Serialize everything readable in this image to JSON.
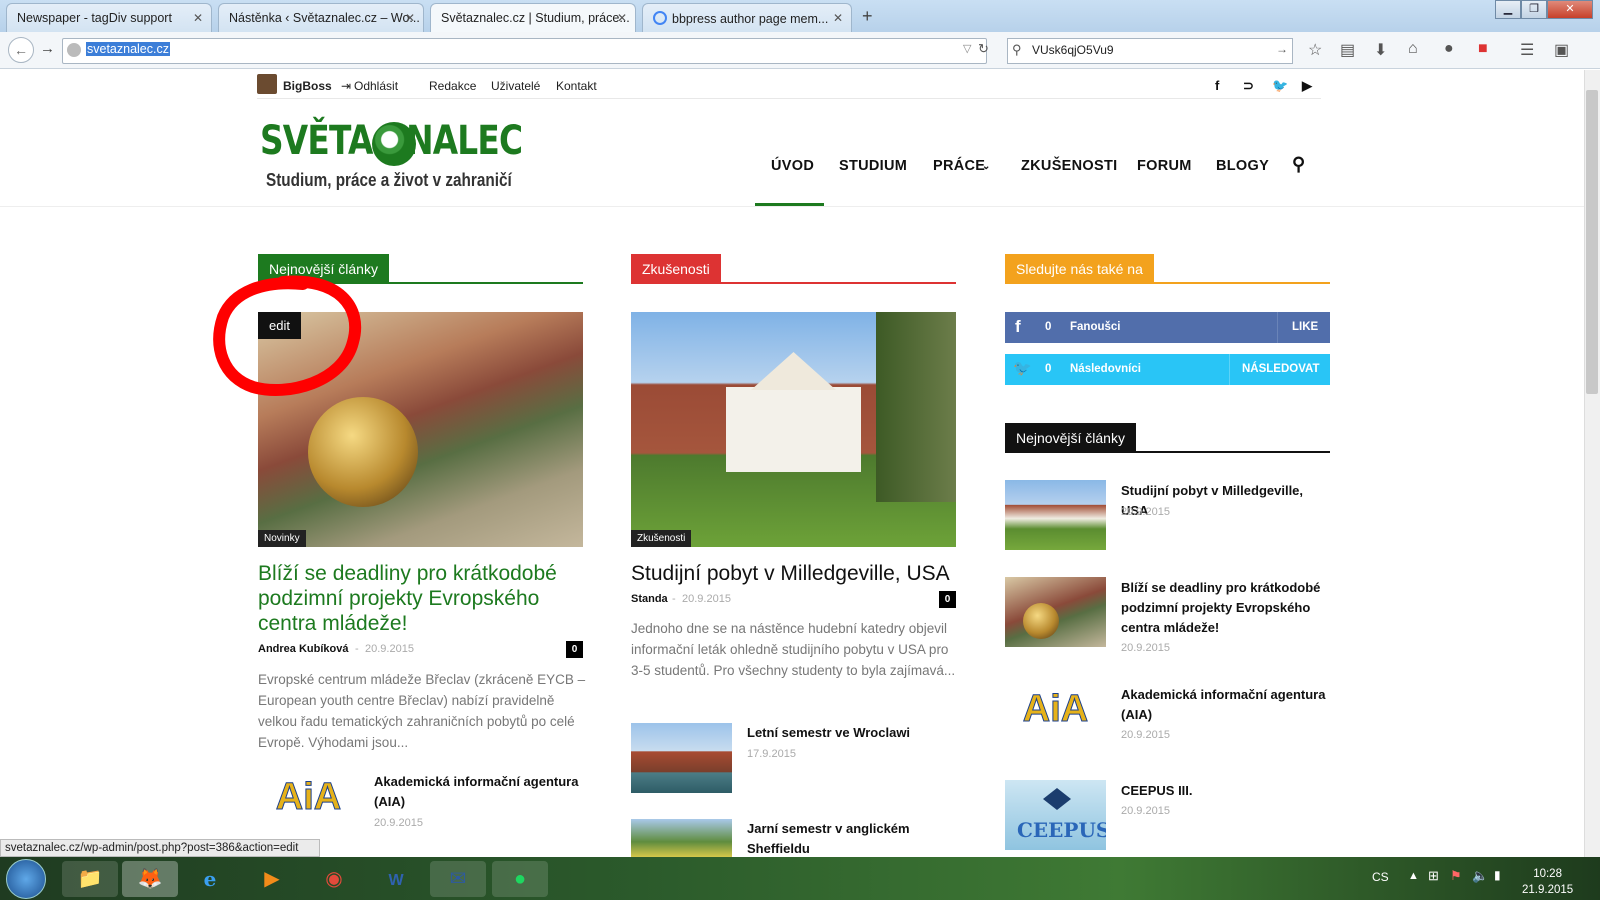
{
  "browser": {
    "tabs": [
      {
        "label": "Newspaper - tagDiv support"
      },
      {
        "label": "Nástěnka ‹ Světaznalec.cz – Wo..."
      },
      {
        "label": "Světaznalec.cz | Studium, práce..."
      },
      {
        "label": "bbpress author page mem..."
      }
    ],
    "url": "svetaznalec.cz",
    "search_query": "VUsk6qjO5Vu9",
    "status_url": "svetaznalec.cz/wp-admin/post.php?post=386&action=edit"
  },
  "topbar": {
    "user": "BigBoss",
    "logout": "Odhlásit",
    "menu": [
      "Redakce",
      "Uživatelé",
      "Kontakt"
    ]
  },
  "logo": {
    "line1": "SVĚTA  ZNALEC",
    "line2": "Studium, práce a život v zahraničí"
  },
  "main_nav": [
    "ÚVOD",
    "STUDIUM",
    "PRÁCE",
    "ZKUŠENOSTI",
    "FORUM",
    "BLOGY"
  ],
  "col1": {
    "heading": "Nejnovější články",
    "edit_label": "edit",
    "category": "Novinky",
    "title": "Blíží se deadliny pro krátkodobé podzimní projekty Evropského centra mládeže!",
    "author": "Andrea Kubíková",
    "date": "20.9.2015",
    "comments": "0",
    "excerpt": "Evropské centrum mládeže Břeclav (zkráceně EYCB – European youth centre Břeclav) nabízí pravidelně velkou řadu tematických zahraničních pobytů po celé Evropě. Výhodami jsou...",
    "small": [
      {
        "title": "Akademická informační agentura (AIA)",
        "date": "20.9.2015"
      }
    ]
  },
  "col2": {
    "heading": "Zkušenosti",
    "category": "Zkušenosti",
    "title": "Studijní pobyt v Milledgeville, USA",
    "author": "Standa",
    "date": "20.9.2015",
    "comments": "0",
    "excerpt": "Jednoho dne se na nástěnce hudební katedry objevil informační leták ohledně studijního pobytu v USA pro 3-5 studentů. Pro všechny studenty to byla zajímavá...",
    "small": [
      {
        "title": "Letní semestr ve Wroclawi",
        "date": "17.9.2015"
      },
      {
        "title": "Jarní semestr v anglickém Sheffieldu",
        "date": ""
      }
    ]
  },
  "col3": {
    "social_heading": "Sledujte nás také na",
    "facebook": {
      "count": "0",
      "label": "Fanoušci",
      "action": "LIKE"
    },
    "twitter": {
      "count": "0",
      "label": "Následovníci",
      "action": "NÁSLEDOVAT"
    },
    "heading": "Nejnovější články",
    "items": [
      {
        "title": "Studijní pobyt v Milledgeville, USA",
        "date": "20.9.2015"
      },
      {
        "title": "Blíží se deadliny pro krátkodobé podzimní projekty Evropského centra mládeže!",
        "date": "20.9.2015"
      },
      {
        "title": "Akademická informační agentura (AIA)",
        "date": "20.9.2015"
      },
      {
        "title": "CEEPUS III.",
        "date": "20.9.2015"
      }
    ]
  },
  "taskbar": {
    "lang": "CS",
    "time": "10:28",
    "date": "21.9.2015"
  },
  "colors": {
    "green": "#1d7a1f",
    "red": "#dd3333",
    "orange": "#f3a21d",
    "facebook": "#516eab",
    "twitter": "#29c5f6"
  }
}
